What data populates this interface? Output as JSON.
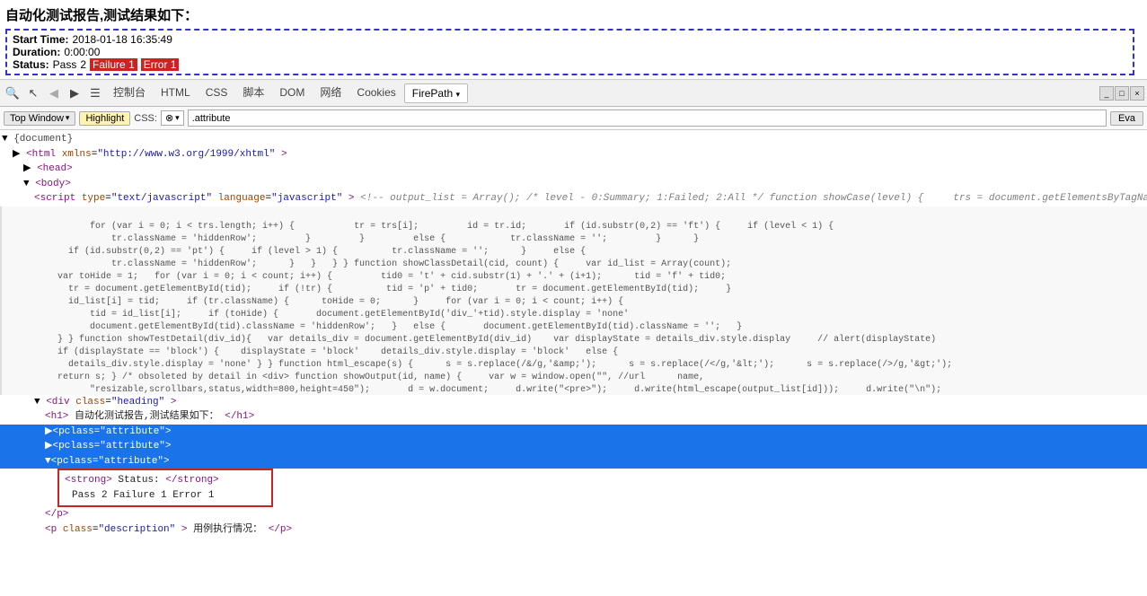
{
  "report": {
    "title": "自动化测试报告,测试结果如下：",
    "start_time_label": "Start Time:",
    "start_time_value": "2018-01-18 16:35:49",
    "duration_label": "Duration:",
    "duration_value": "0:00:00",
    "status_label": "Status:",
    "status_pass": "Pass",
    "status_pass_num": "2",
    "status_failure": "Failure",
    "status_failure_num": "1",
    "status_error": "Error",
    "status_error_num": "1"
  },
  "devtools": {
    "tabs": [
      "控制台",
      "HTML",
      "CSS",
      "脚本",
      "DOM",
      "网络",
      "Cookies",
      "FirePath"
    ],
    "active_tab": "FirePath"
  },
  "firepath_bar": {
    "top_window_label": "Top Window",
    "highlight_label": "Highlight",
    "css_label": "CSS:",
    "css_mode": "⊗",
    "xpath_value": ".attribute",
    "eval_label": "Eva"
  },
  "dom_tree": {
    "document_label": "▼ {document}",
    "html_tag": "html",
    "html_attr": "xmlns",
    "html_attr_value": "\"http://www.w3.org/1999/xhtml\"",
    "head_tag": "head",
    "body_tag": "body",
    "script_type": "text/javascript",
    "script_lang": "javascript",
    "div_class": "heading",
    "h1_text": "自动化测试报告,测试结果如下：",
    "p_class_1": "attribute",
    "p_class_2": "attribute",
    "p_class_3": "attribute",
    "strong_text": "Status:",
    "status_text": "Pass  2  Failure  1  Error  1",
    "p_end": "</p>",
    "p_description_class": "description",
    "p_description_text": "用例执行情况：",
    "p_description_end": "</p>"
  },
  "code_content": "<!-- output_list = Array(); /* level - 0:Summary; 1:Failed; 2:All */ function showCase(level) {     trs = document.getElementsByTagName(\"tr\");\n    for (var i = 0; i < trs.length; i++) {           tr = trs[i];         id = tr.id;       if (id.substr(0,2) == 'ft') {     if (level < 1) {\n            tr.className = 'hiddenRow';         }         }         else {            tr.className = '';         }      }\n    if (id.substr(0,2) == 'pt') {     if (level > 1) {          tr.className = '';      }     else {\n            tr.className = 'hiddenRow';      }   }   } } function showClassDetail(cid, count) {     var id_list = Array(count);\n  var toHide = 1;   for (var i = 0; i < count; i++) {         tid0 = 't' + cid.substr(1) + '.' + (i+1);      tid = 'f' + tid0;\n    tr = document.getElementById(tid);     if (!tr) {          tid = 'p' + tid0;       tr = document.getElementById(tid);     }\n    id_list[i] = tid;     if (tr.className) {      toHide = 0;      }     for (var i = 0; i < count; i++) {\n        tid = id_list[i];     if (toHide) {       document.getElementById('div_'+tid).style.display = 'none'\n        document.getElementById(tid).className = 'hiddenRow';   }   else {       document.getElementById(tid).className = '';   }\n  } } function showTestDetail(div_id){   var details_div = document.getElementById(div_id)    var displayState = details_div.style.display     // alert(displayState)\n  if (displayState == 'block') {    displayState = 'block'    details_div.style.display = 'block'   else {\n    details_div.style.display = 'none' } } function html_escape(s) {      s = s.replace(/&/g,'&amp;');      s = s.replace(/</g,'&lt;');      s = s.replace(/>/g,'&gt;');\n  return s; } /* obsoleted by detail in <div> function showOutput(id, name) {     var w = window.open(\"\", //url      name,\n        \"resizable,scrollbars,status,width=800,height=450\");       d = w.document;     d.write('<pre>');     d.write(html_escape(output_list[id]));     d.write('\\n');\n  d.write('</pre>\\n');     d.close(); } */ -->",
  "icons": {
    "expand": "▶",
    "collapse": "▼",
    "checkbox_expand": "▶",
    "arrow_left": "◀",
    "arrow_right": "▶",
    "list_icon": "☰",
    "inspect_icon": "⊕",
    "caret_down": "▾"
  }
}
